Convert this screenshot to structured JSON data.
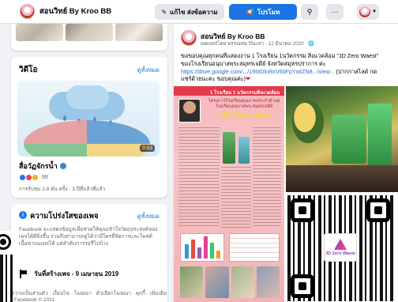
{
  "header": {
    "page_name": "สอนวิทย์ By Kroo BB",
    "edit_label": "แก้ไข ส่งข้อความ",
    "promote_label": "โปรโมท",
    "search_icon": "search-icon",
    "more_icon": "more-icon"
  },
  "video_card": {
    "title": "วิดีโอ",
    "see_all": "ดูทั้งหมด",
    "duration": "0:53",
    "caption": "สื่อวัฏจักรน้ำ",
    "reaction_count": "99",
    "meta": "การรับชม 2.8 พัน ครั้ง · 3 ปีที่แล้วที่แล้ว"
  },
  "transparency": {
    "title": "ความโปร่งใสของเพจ",
    "see_all": "ดูทั้งหมด",
    "description": "Facebook จะแสดงข้อมูลเพื่อช่วยให้คุณเข้าใจวัตถุประสงค์ของเพจได้ดียิ่งขึ้น รวมถึงสามารถดูได้ว่ามีใครที่จัดการและโพสต์เนื้อหาบนเพจได้ แต่ลำดับการรอรีไปบ้าง",
    "created_label": "วันที่สร้างเพจ - 9 เมษายน 2019"
  },
  "footer": {
    "links": "ความเป็นส่วนตัว · เงื่อนไข · โฆษณา · ตัวเลือกโฆษณา · คุกกี้ · เพิ่มเติม · Facebook © 2021"
  },
  "post": {
    "author": "สอนวิทย์ By Kroo BB",
    "meta": "เผยแพร่โดย พรรณทม ปินะทา · 12 มีนาคม 2020 · 🌐",
    "text_1": "ขอขอบคุณทุกคนที่แสดงงาน 1 โรงเรียน 1นวัตกรรม สิ่งแวดล้อม \"JD Zero Waest\" ของโรงเรียนอนุบาลพระสมุทรเจดีย์ จังหวัดสมุทรปราการ ค่ะ",
    "link": "https://drive.google.com/.../195tDlnRxV60FpYwIZN8.../view...",
    "text_2": "(ปากกาสไลด์ กดแชร์ด้วยนะคะ ขอบคุณค่ะ)",
    "heart": "❤",
    "image": {
      "band_title": "1 โรงเรียน 1 นวัตกรรมสิ่งแวดล้อม",
      "green_tag": "โรงเรียนพระสมุทรเจดีย์",
      "sub_title": "โครงการโรงเรียนคุณภาพประจำตำบล โรงเรียนอนุบาลพระสมุทรเจดีย์",
      "zero_title": "\"JD Zero Was",
      "qr_center_text": "JD Zero Waste"
    }
  }
}
